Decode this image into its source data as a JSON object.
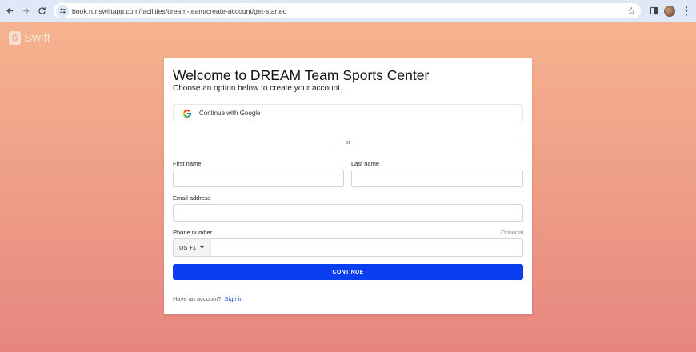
{
  "browser": {
    "url": "book.runswiftapp.com/facilities/dream-team/create-account/get-started",
    "icons": [
      "back-arrow-icon",
      "forward-arrow-icon",
      "reload-icon",
      "site-settings-icon",
      "bookmark-star-icon",
      "side-panel-icon",
      "profile-avatar",
      "menu-dots-icon"
    ]
  },
  "brand": {
    "logo_letter": "S",
    "name": "Swift"
  },
  "form": {
    "title": "Welcome to DREAM Team Sports Center",
    "subtitle": "Choose an option below to create your account.",
    "google_button": "Continue with Google",
    "divider_text": "or",
    "first_name_label": "First name",
    "first_name_value": "",
    "last_name_label": "Last name",
    "last_name_value": "",
    "email_label": "Email address",
    "email_value": "",
    "phone_label": "Phone number",
    "phone_optional": "Optional",
    "country_code": "US +1",
    "phone_value": "",
    "continue_button": "CONTINUE",
    "have_account_text": "Have an account?",
    "sign_in_link": "Sign in"
  },
  "colors": {
    "primary_button": "#0b3ef0",
    "link": "#1d4ed8",
    "background_top": "#f5b38e",
    "background_bottom": "#e6867f"
  }
}
